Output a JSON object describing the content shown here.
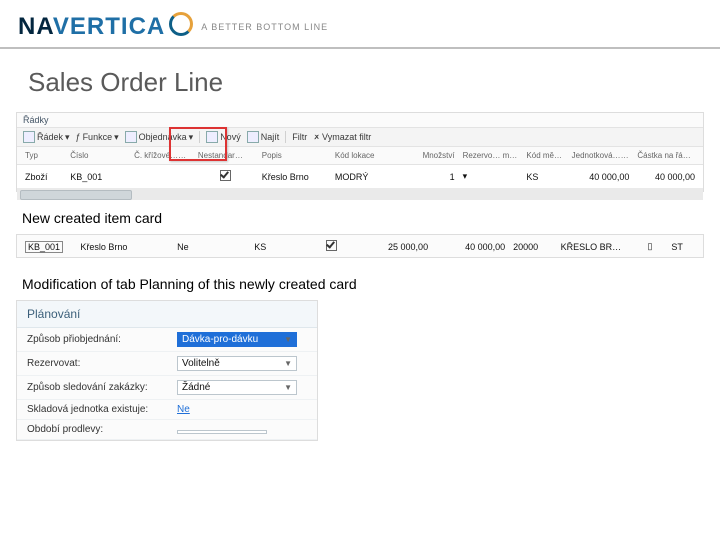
{
  "brand": {
    "name_a": "NA",
    "name_b": "VERTICA",
    "tagline": "A BETTER BOTTOM LINE"
  },
  "slide": {
    "title": "Sales Order Line"
  },
  "lines_panel": {
    "caption": "Řádky",
    "toolbar": {
      "radek": "Řádek",
      "funkce": "Funkce",
      "objednavka": "Objednávka",
      "novy": "Nový",
      "najit": "Najít",
      "filtr": "Filtr",
      "vymazat": "Vymazat filtr"
    },
    "columns": [
      "Typ",
      "Číslo",
      "Č. křížové…odkazu",
      "Nestandar…",
      "Popis",
      "Kód lokace",
      "Množství",
      "Rezervo… množství",
      "Kód měrné…",
      "Jednotková… bez DPH",
      "Částka na řádku bez DPH"
    ],
    "row": {
      "typ": "Zboží",
      "cislo": "KB_001",
      "kriz": "",
      "nestandar_checked": true,
      "popis": "Křeslo Brno",
      "lokace": "MODRÝ",
      "mnozstvi": "1",
      "rez": "",
      "uom": "KS",
      "unit_price": "40 000,00",
      "line_amount": "40 000,00"
    }
  },
  "caption_newcard": "New created item card",
  "item_card_row": {
    "no": "KB_001",
    "popis": "Křeslo Brno",
    "col3": "Ne",
    "uom": "KS",
    "flag_checked": true,
    "cost": "25 000,00",
    "price": "40 000,00",
    "vendor": "20000",
    "search": "KŘESLO  BR…",
    "tail_icon": "▯",
    "tail": "ST"
  },
  "caption_planning": "Modification of tab Planning of this newly created card",
  "planning_panel": {
    "title": "Plánování",
    "rows": {
      "reorder_policy_label": "Způsob přiobjednání:",
      "reorder_policy_value": "Dávka-pro-dávku",
      "reserve_label": "Rezervovat:",
      "reserve_value": "Volitelně",
      "order_tracking_label": "Způsob sledování zakázky:",
      "order_tracking_value": "Žádné",
      "sku_exists_label": "Skladová jednotka existuje:",
      "sku_exists_value": "Ne",
      "dampener_label": "Období prodlevy:",
      "dampener_value": ""
    }
  }
}
